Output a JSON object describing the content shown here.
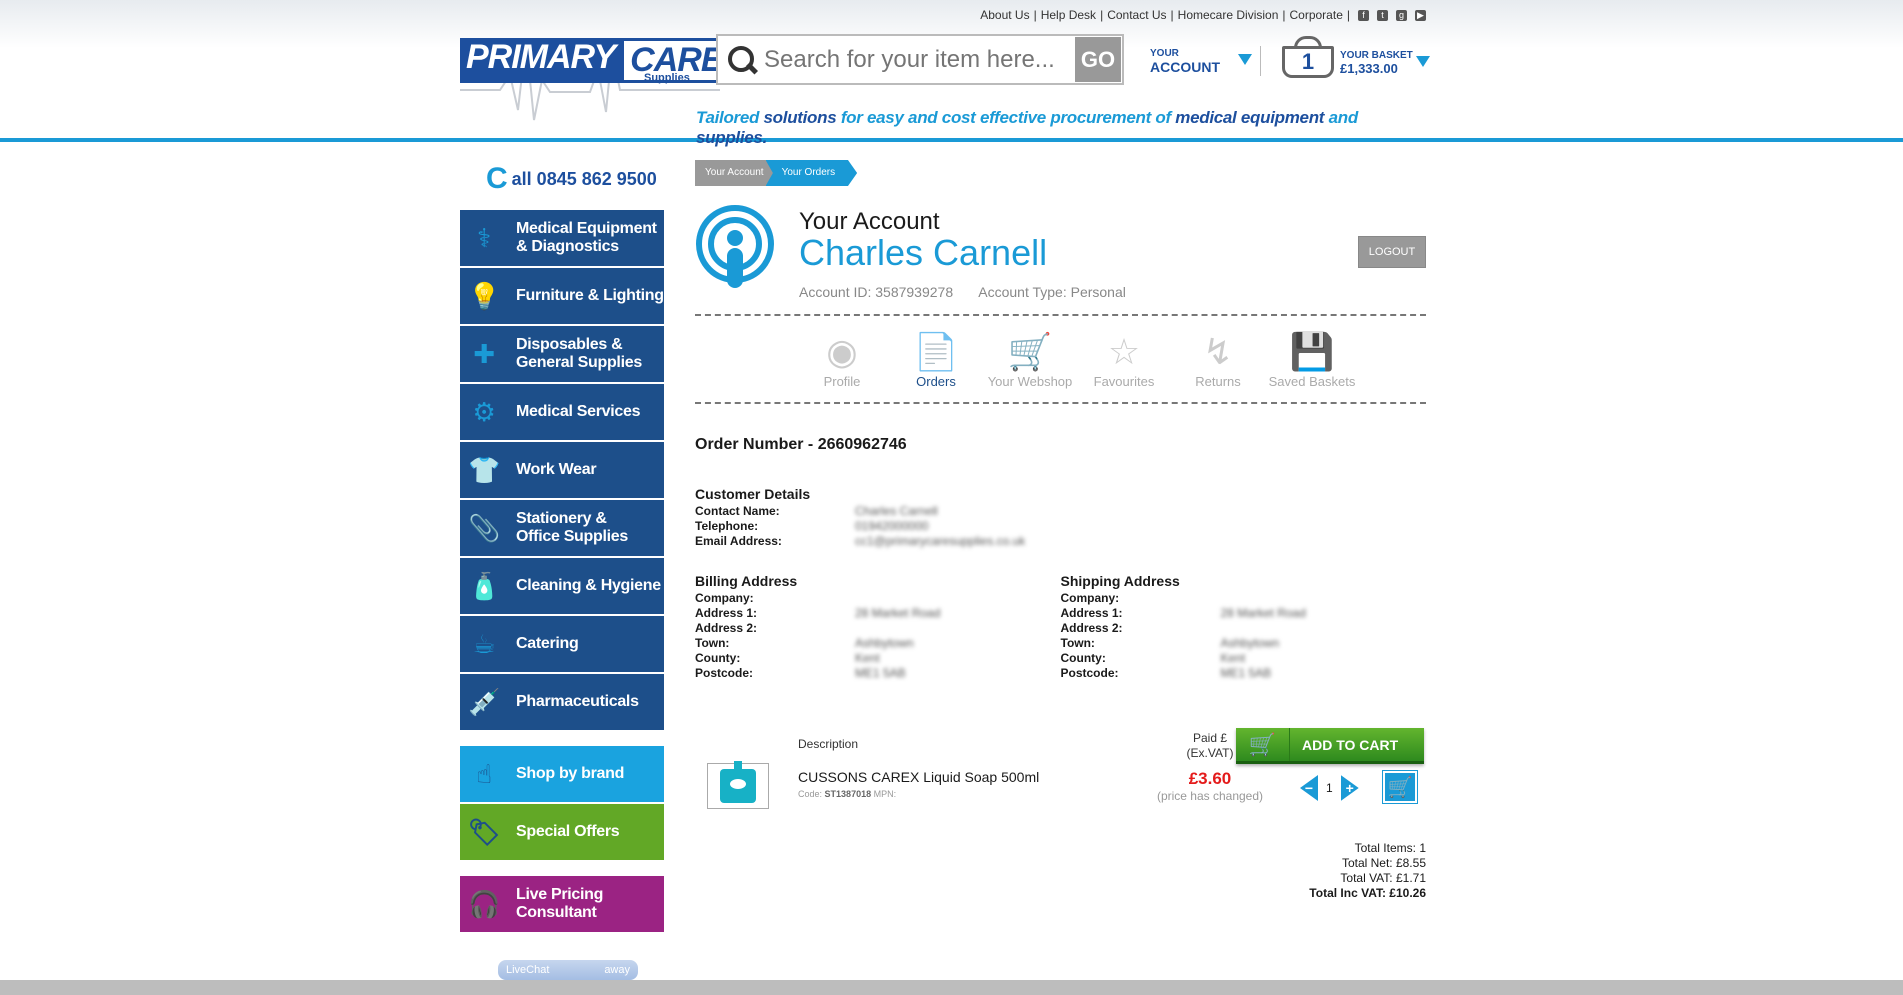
{
  "toplinks": {
    "about": "About Us",
    "helpdesk": "Help Desk",
    "contact": "Contact Us",
    "homecare": "Homecare Division",
    "corporate": "Corporate"
  },
  "logo": {
    "word1": "PRIMARY",
    "word2": "CARE",
    "sub": "Supplies"
  },
  "search": {
    "placeholder": "Search for your item here...",
    "go": "GO"
  },
  "account_menu": {
    "line1": "YOUR",
    "line2": "ACCOUNT"
  },
  "basket": {
    "count": "1",
    "label": "YOUR BASKET",
    "amount": "£1,333.00"
  },
  "tagline": {
    "a": "Tailored ",
    "b": "solutions ",
    "c": "for easy and cost effective  procurement of ",
    "d": "medical equipment ",
    "e": "and ",
    "f": "supplies."
  },
  "call": {
    "c": "C",
    "text": "all 0845 862 9500"
  },
  "nav": {
    "items": [
      {
        "line1": "Medical Equipment",
        "line2": "& Diagnostics",
        "icon": "stethoscope-icon"
      },
      {
        "line1": "Furniture & Lighting",
        "line2": "",
        "icon": "lamp-icon"
      },
      {
        "line1": "Disposables &",
        "line2": "General Supplies",
        "icon": "first-aid-icon"
      },
      {
        "line1": "Medical Services",
        "line2": "",
        "icon": "gears-icon"
      },
      {
        "line1": "Work Wear",
        "line2": "",
        "icon": "shirt-icon"
      },
      {
        "line1": "Stationery &",
        "line2": "Office Supplies",
        "icon": "paperclip-icon"
      },
      {
        "line1": "Cleaning & Hygiene",
        "line2": "",
        "icon": "spray-icon"
      },
      {
        "line1": "Catering",
        "line2": "",
        "icon": "mug-icon"
      },
      {
        "line1": "Pharmaceuticals",
        "line2": "",
        "icon": "syringe-icon"
      }
    ],
    "brand": "Shop by brand",
    "offers": "Special Offers",
    "live_line1": "Live Pricing",
    "live_line2": "Consultant"
  },
  "livechat": {
    "label": "LiveChat",
    "status": "away"
  },
  "breadcrumbs": [
    "Your Account",
    "Your Orders"
  ],
  "account": {
    "title": "Your Account",
    "name": "Charles Carnell",
    "id": "Account ID: 3587939278",
    "type": "Account Type: Personal",
    "logout": "LOGOUT"
  },
  "tabs": [
    "Profile",
    "Orders",
    "Your Webshop",
    "Favourites",
    "Returns",
    "Saved Baskets"
  ],
  "order": {
    "number": "Order Number - 2660962746",
    "customer_title": "Customer Details",
    "contact_label": "Contact Name:",
    "contact_value": "Charles Carnell",
    "tel_label": "Telephone:",
    "tel_value": "01942000000",
    "email_label": "Email Address:",
    "email_value": "cc1@primarycaresupplies.co.uk",
    "billing_title": "Billing Address",
    "shipping_title": "Shipping Address",
    "company_label": "Company:",
    "addr1_label": "Address 1:",
    "addr2_label": "Address 2:",
    "town_label": "Town:",
    "county_label": "County:",
    "postcode_label": "Postcode:",
    "billing_addr1": "28 Market Road",
    "billing_town": "Ashbytown",
    "billing_county": "Kent",
    "billing_postcode": "ME1 5AB",
    "shipping_addr1": "28 Market Road",
    "shipping_town": "Ashbytown",
    "shipping_county": "Kent",
    "shipping_postcode": "ME1 5AB"
  },
  "item": {
    "desc_header": "Description",
    "paid_header_1": "Paid £",
    "paid_header_2": "(Ex.VAT)",
    "name": "CUSSONS CAREX Liquid Soap 500ml",
    "code_label": "Code:",
    "code": "ST1387018",
    "mpn_label": "MPN:",
    "price": "£3.60",
    "price_note": "(price has changed)",
    "qty": "1"
  },
  "totals": {
    "items": "Total Items: 1",
    "net": "Total Net: £8.55",
    "vat": "Total VAT: £1.71",
    "inc": "Total Inc VAT: £10.26"
  },
  "add_to_cart": "ADD TO CART"
}
